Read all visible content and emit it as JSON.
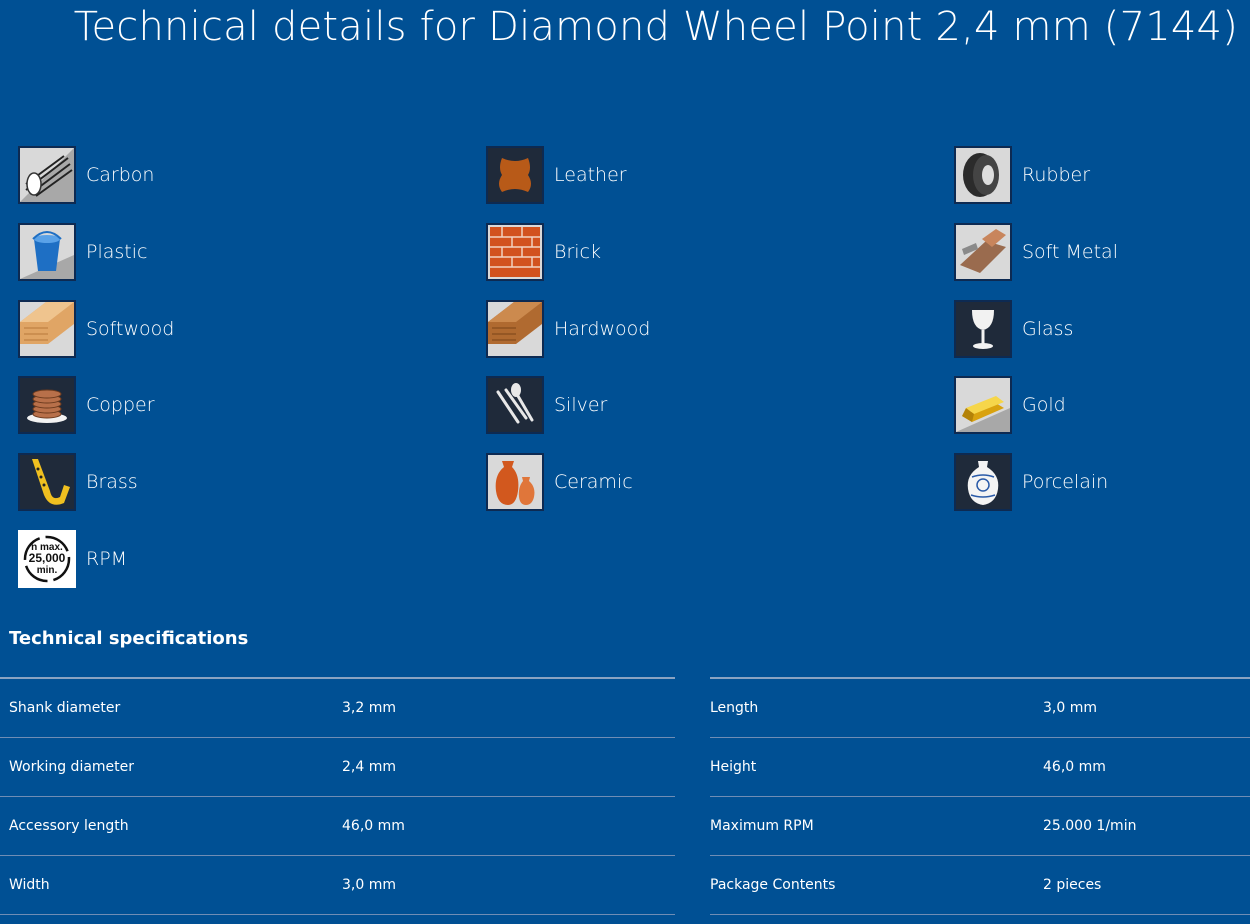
{
  "page_title": "Technical details for Diamond Wheel Point 2,4 mm (7144)",
  "materials": {
    "carbon": "Carbon",
    "leather": "Leather",
    "rubber": "Rubber",
    "plastic": "Plastic",
    "brick": "Brick",
    "soft_metal": "Soft Metal",
    "softwood": "Softwood",
    "hardwood": "Hardwood",
    "glass": "Glass",
    "copper": "Copper",
    "silver": "Silver",
    "gold": "Gold",
    "brass": "Brass",
    "ceramic": "Ceramic",
    "porcelain": "Porcelain",
    "rpm": "RPM"
  },
  "rpm_icon_text": {
    "line1": "n max.",
    "line2": "25,000",
    "line3": "min."
  },
  "specs": {
    "title": "Technical specifications",
    "left": [
      {
        "name": "Shank diameter",
        "value": "3,2 mm"
      },
      {
        "name": "Working diameter",
        "value": "2,4 mm"
      },
      {
        "name": "Accessory length",
        "value": "46,0 mm"
      },
      {
        "name": "Width",
        "value": "3,0 mm"
      }
    ],
    "right": [
      {
        "name": "Length",
        "value": "3,0 mm"
      },
      {
        "name": "Height",
        "value": "46,0 mm"
      },
      {
        "name": "Maximum RPM",
        "value": "25.000 1/min"
      },
      {
        "name": "Package Contents",
        "value": "2 pieces"
      }
    ]
  },
  "colors": {
    "background": "#005094",
    "divider": "#6f8db5",
    "icon_border": "#0d2a52"
  }
}
